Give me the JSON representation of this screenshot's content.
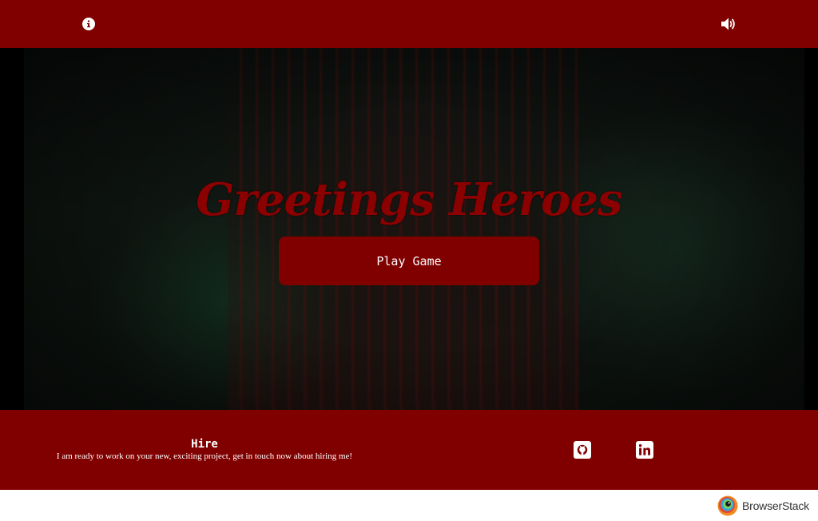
{
  "header": {
    "info_icon": "info-circle-icon",
    "sound_icon": "volume-up-icon"
  },
  "hero": {
    "title": "Greetings Heroes",
    "play_button_label": "Play Game"
  },
  "footer": {
    "hire_title": "Hire",
    "hire_text": "I am ready to work on your new, exciting project, get in touch now about hiring me!",
    "github_icon": "github-icon",
    "linkedin_icon": "linkedin-icon"
  },
  "watermark": {
    "brand_label": "BrowserStack",
    "brand_icon": "browserstack-logo-icon"
  },
  "colors": {
    "primary": "#800000",
    "title": "#8b0000",
    "text_on_primary": "#ffffff"
  }
}
